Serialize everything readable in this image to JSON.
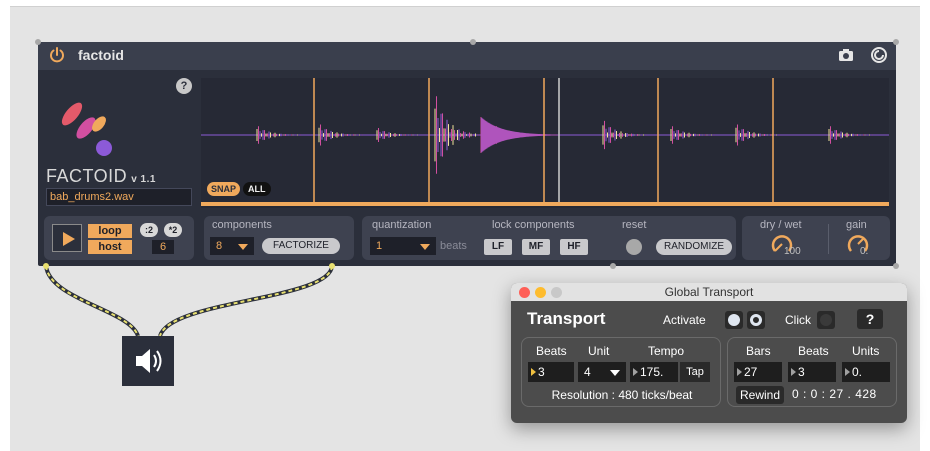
{
  "device": {
    "title": "factoid",
    "logo_name": "FACTOID",
    "version": "v 1.1",
    "filename": "bab_drums2.wav",
    "help": "?",
    "snap": "SNAP",
    "all": "ALL",
    "transport": {
      "loop": "loop",
      "host": "host",
      "div2": ":2",
      "mul2": "*2",
      "host_value": "6"
    },
    "components": {
      "label": "components",
      "value": "8",
      "factorize": "FACTORIZE"
    },
    "quantization": {
      "label": "quantization",
      "value": "1",
      "unit": "beats"
    },
    "lock": {
      "label": "lock components",
      "buttons": [
        "LF",
        "MF",
        "HF"
      ]
    },
    "reset": {
      "label": "reset",
      "randomize": "RANDOMIZE"
    },
    "drywet": {
      "label": "dry / wet",
      "value": "100"
    },
    "gain": {
      "label": "gain",
      "value": "0."
    }
  },
  "global_transport": {
    "window_title": "Global Transport",
    "heading": "Transport",
    "activate_label": "Activate",
    "click_label": "Click",
    "help": "?",
    "left": {
      "headers": [
        "Beats",
        "Unit",
        "Tempo"
      ],
      "beats": "3",
      "unit": "4",
      "tempo": "175.",
      "tap": "Tap",
      "resolution": "Resolution : 480 ticks/beat"
    },
    "right": {
      "headers": [
        "Bars",
        "Beats",
        "Units"
      ],
      "bars": "27",
      "beats": "3",
      "units": "0.",
      "rewind": "Rewind",
      "time": "0 : 0 : 27 . 428"
    }
  },
  "colors": {
    "accent": "#f0a95c",
    "device_bg": "#2b2f3b",
    "wave_pink": "#d24fa0",
    "wave_purple": "#8c5ad8",
    "wave_yellow": "#f2e39a"
  },
  "icons": [
    "power-icon",
    "camera-icon",
    "link-icon",
    "speaker-icon"
  ]
}
